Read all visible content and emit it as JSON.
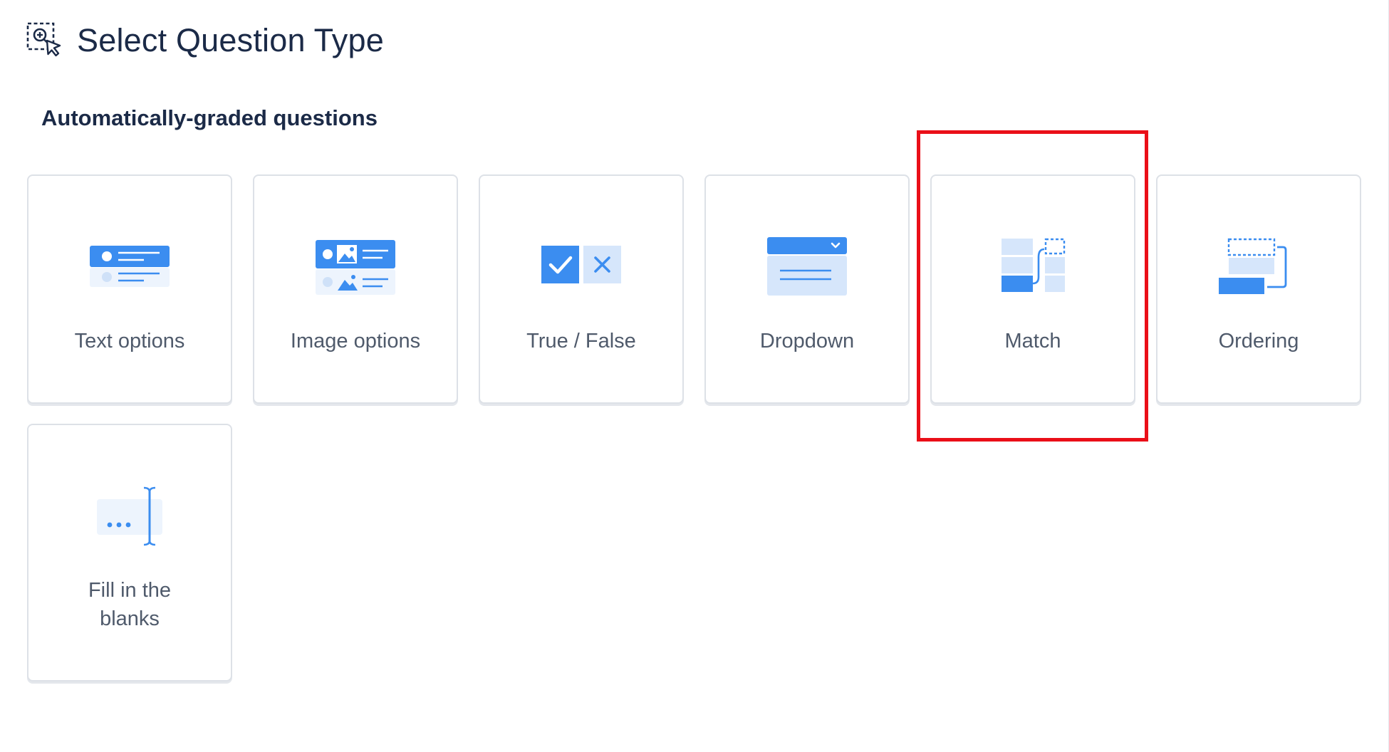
{
  "header": {
    "title": "Select Question Type",
    "icon": "select-area-cursor-icon"
  },
  "section": {
    "heading": "Automatically-graded questions"
  },
  "question_types": [
    {
      "label": "Text options",
      "icon": "text-options-icon"
    },
    {
      "label": "Image options",
      "icon": "image-options-icon"
    },
    {
      "label": "True / False",
      "icon": "true-false-icon"
    },
    {
      "label": "Dropdown",
      "icon": "dropdown-icon"
    },
    {
      "label": "Match",
      "icon": "match-icon"
    },
    {
      "label": "Ordering",
      "icon": "ordering-icon"
    },
    {
      "label": "Fill in the blanks",
      "icon": "fill-in-the-blanks-icon"
    }
  ],
  "highlighted_type": "Match",
  "colors": {
    "accent_blue": "#3b8df0",
    "light_blue": "#d6e6fb",
    "highlight_red": "#ea0f18",
    "title_text": "#1b2a47",
    "label_text": "#4f5a6b"
  }
}
